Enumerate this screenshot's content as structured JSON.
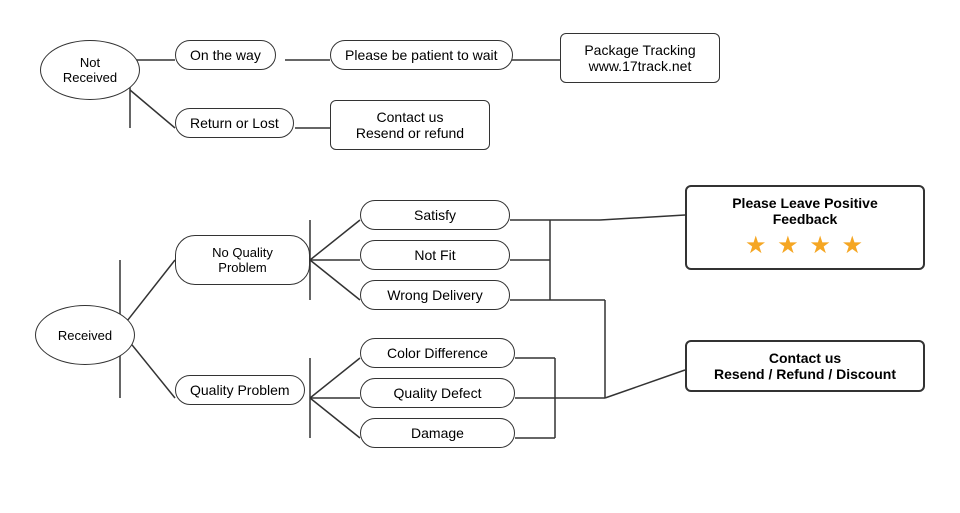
{
  "nodes": {
    "not_received": "Not\nReceived",
    "on_the_way": "On the way",
    "return_or_lost": "Return or Lost",
    "patient": "Please be patient to wait",
    "contact_resend": "Contact us\nResend or refund",
    "package_tracking": "Package Tracking\nwww.17track.net",
    "received": "Received",
    "no_quality_problem": "No Quality\nProblem",
    "quality_problem": "Quality Problem",
    "satisfy": "Satisfy",
    "not_fit": "Not Fit",
    "wrong_delivery": "Wrong Delivery",
    "color_difference": "Color Difference",
    "quality_defect": "Quality Defect",
    "damage": "Damage",
    "please_leave": "Please Leave Positive Feedback",
    "stars": "★ ★ ★ ★",
    "contact_refund": "Contact us\nResend / Refund / Discount"
  }
}
